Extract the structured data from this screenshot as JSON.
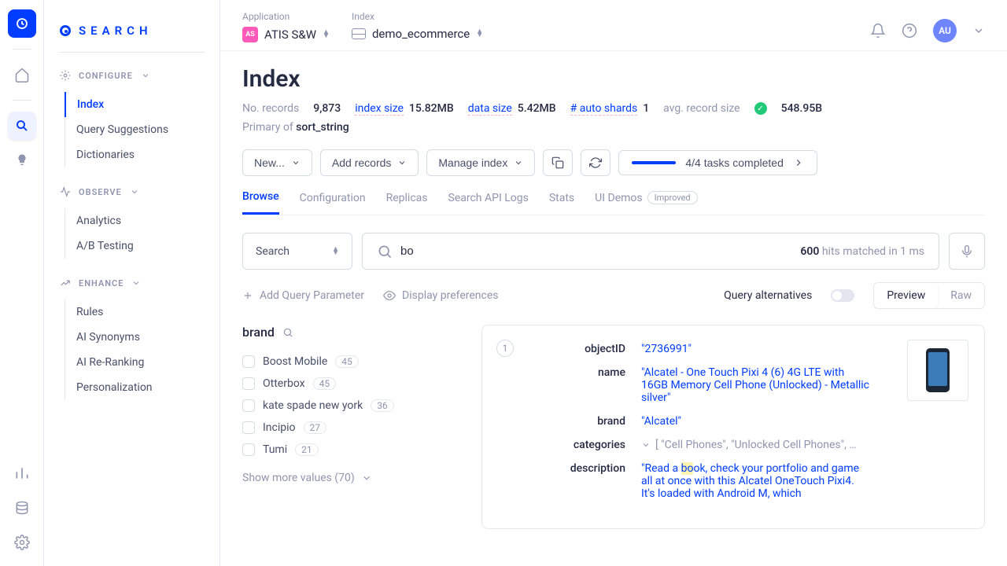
{
  "sidebar": {
    "title": "SEARCH",
    "sections": [
      {
        "label": "CONFIGURE",
        "items": [
          "Index",
          "Query Suggestions",
          "Dictionaries"
        ],
        "active": 0
      },
      {
        "label": "OBSERVE",
        "items": [
          "Analytics",
          "A/B Testing"
        ]
      },
      {
        "label": "ENHANCE",
        "items": [
          "Rules",
          "AI Synonyms",
          "AI Re-Ranking",
          "Personalization"
        ]
      }
    ]
  },
  "topbar": {
    "app_label": "Application",
    "app_badge": "AS",
    "app_name": "ATIS S&W",
    "index_label": "Index",
    "index_name": "demo_ecommerce",
    "avatar": "AU"
  },
  "page": {
    "title": "Index",
    "stats": {
      "no_records_label": "No. records",
      "no_records": "9,873",
      "index_size_label": "index size",
      "index_size": "15.82MB",
      "data_size_label": "data size",
      "data_size": "5.42MB",
      "shards_label": "# auto shards",
      "shards": "1",
      "avg_label": "avg. record size",
      "avg": "548.95B"
    },
    "primary_of_label": "Primary of ",
    "primary_of": "sort_string",
    "toolbar": {
      "new": "New...",
      "add": "Add records",
      "manage": "Manage index",
      "tasks": "4/4 tasks completed"
    },
    "tabs": [
      "Browse",
      "Configuration",
      "Replicas",
      "Search API Logs",
      "Stats",
      "UI Demos"
    ],
    "tabs_badge": "Improved",
    "search_mode": "Search",
    "search_value": "bo",
    "hits_count": "600",
    "hits_suffix": " hits matched in 1 ms",
    "add_param": "Add Query Parameter",
    "display_prefs": "Display preferences",
    "query_alt": "Query alternatives",
    "preview": "Preview",
    "raw": "Raw",
    "facet_title": "brand",
    "facets": [
      {
        "label": "Boost Mobile",
        "count": "45"
      },
      {
        "label": "Otterbox",
        "count": "45"
      },
      {
        "label": "kate spade new york",
        "count": "36"
      },
      {
        "label": "Incipio",
        "count": "27"
      },
      {
        "label": "Tumi",
        "count": "21"
      }
    ],
    "show_more": "Show more values (70)",
    "record": {
      "num": "1",
      "objectID_k": "objectID",
      "objectID_v": "\"2736991\"",
      "name_k": "name",
      "name_v": "\"Alcatel - One Touch Pixi 4 (6) 4G LTE with 16GB Memory Cell Phone (Unlocked) - Metallic silver\"",
      "brand_k": "brand",
      "brand_v": "\"Alcatel\"",
      "categories_k": "categories",
      "categories_v": "[ \"Cell Phones\", \"Unlocked Cell Phones\", …",
      "description_k": "description",
      "desc_pre": "\"Read a ",
      "desc_hl": "bo",
      "desc_post": "ok, check your portfolio and game all at once with this Alcatel OneTouch Pixi4. It's loaded with Android M, which"
    }
  }
}
